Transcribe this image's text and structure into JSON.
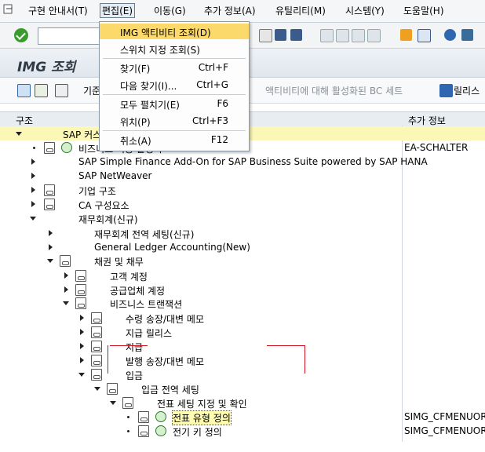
{
  "menubar": {
    "items": [
      "구현 안내서(T)",
      "편집(E)",
      "이동(G)",
      "추가 정보(A)",
      "유틸리티(M)",
      "시스템(Y)",
      "도움말(H)"
    ]
  },
  "title": "IMG 조회",
  "toolbar2": {
    "frag": "기준",
    "bc_sets_label": "액티비티에 대해 활성화된 BC 세트",
    "release_label": "릴리스"
  },
  "columns": {
    "structure": "구조",
    "info": "추가 정보"
  },
  "dropdown": {
    "items": [
      {
        "label": "IMG 액티비티 조회(D)",
        "shortcut": ""
      },
      {
        "label": "스위치 지정 조회(S)",
        "shortcut": ""
      },
      {
        "label": "찾기(F)",
        "shortcut": "Ctrl+F"
      },
      {
        "label": "다음 찾기(I)...",
        "shortcut": "Ctrl+G"
      },
      {
        "label": "모두 펼치기(E)",
        "shortcut": "F6"
      },
      {
        "label": "위치(P)",
        "shortcut": "Ctrl+F3"
      },
      {
        "label": "취소(A)",
        "shortcut": "F12"
      }
    ]
  },
  "tree": [
    {
      "label": "SAP 커스",
      "info": ""
    },
    {
      "label": "비즈니스 기능 활성화",
      "info": "EA-SCHALTER"
    },
    {
      "label": "SAP Simple Finance Add-On for SAP Business Suite powered by SAP HANA",
      "info": ""
    },
    {
      "label": "SAP NetWeaver",
      "info": ""
    },
    {
      "label": "기업 구조",
      "info": ""
    },
    {
      "label": "CA 구성요소",
      "info": ""
    },
    {
      "label": "재무회계(신규)",
      "info": ""
    },
    {
      "label": "재무회계 전역 세팅(신규)",
      "info": ""
    },
    {
      "label": "General Ledger Accounting(New)",
      "info": ""
    },
    {
      "label": "채권 및 채무",
      "info": ""
    },
    {
      "label": "고객 계정",
      "info": ""
    },
    {
      "label": "공급업체 계정",
      "info": ""
    },
    {
      "label": "비즈니스 트랜잭션",
      "info": ""
    },
    {
      "label": "수령 송장/대변 메모",
      "info": ""
    },
    {
      "label": "지급 릴리스",
      "info": ""
    },
    {
      "label": "지급",
      "info": ""
    },
    {
      "label": "발행 송장/대변 메모",
      "info": ""
    },
    {
      "label": "입금",
      "info": ""
    },
    {
      "label": "입금 전역 세팅",
      "info": ""
    },
    {
      "label": "전표 세팅 지정 및 확인",
      "info": ""
    },
    {
      "label": "전표 유형 정의",
      "info": "SIMG_CFMENUORF"
    },
    {
      "label": "전기 키 정의",
      "info": "SIMG_CFMENUORF"
    },
    {
      "label": "",
      "info": ""
    }
  ]
}
